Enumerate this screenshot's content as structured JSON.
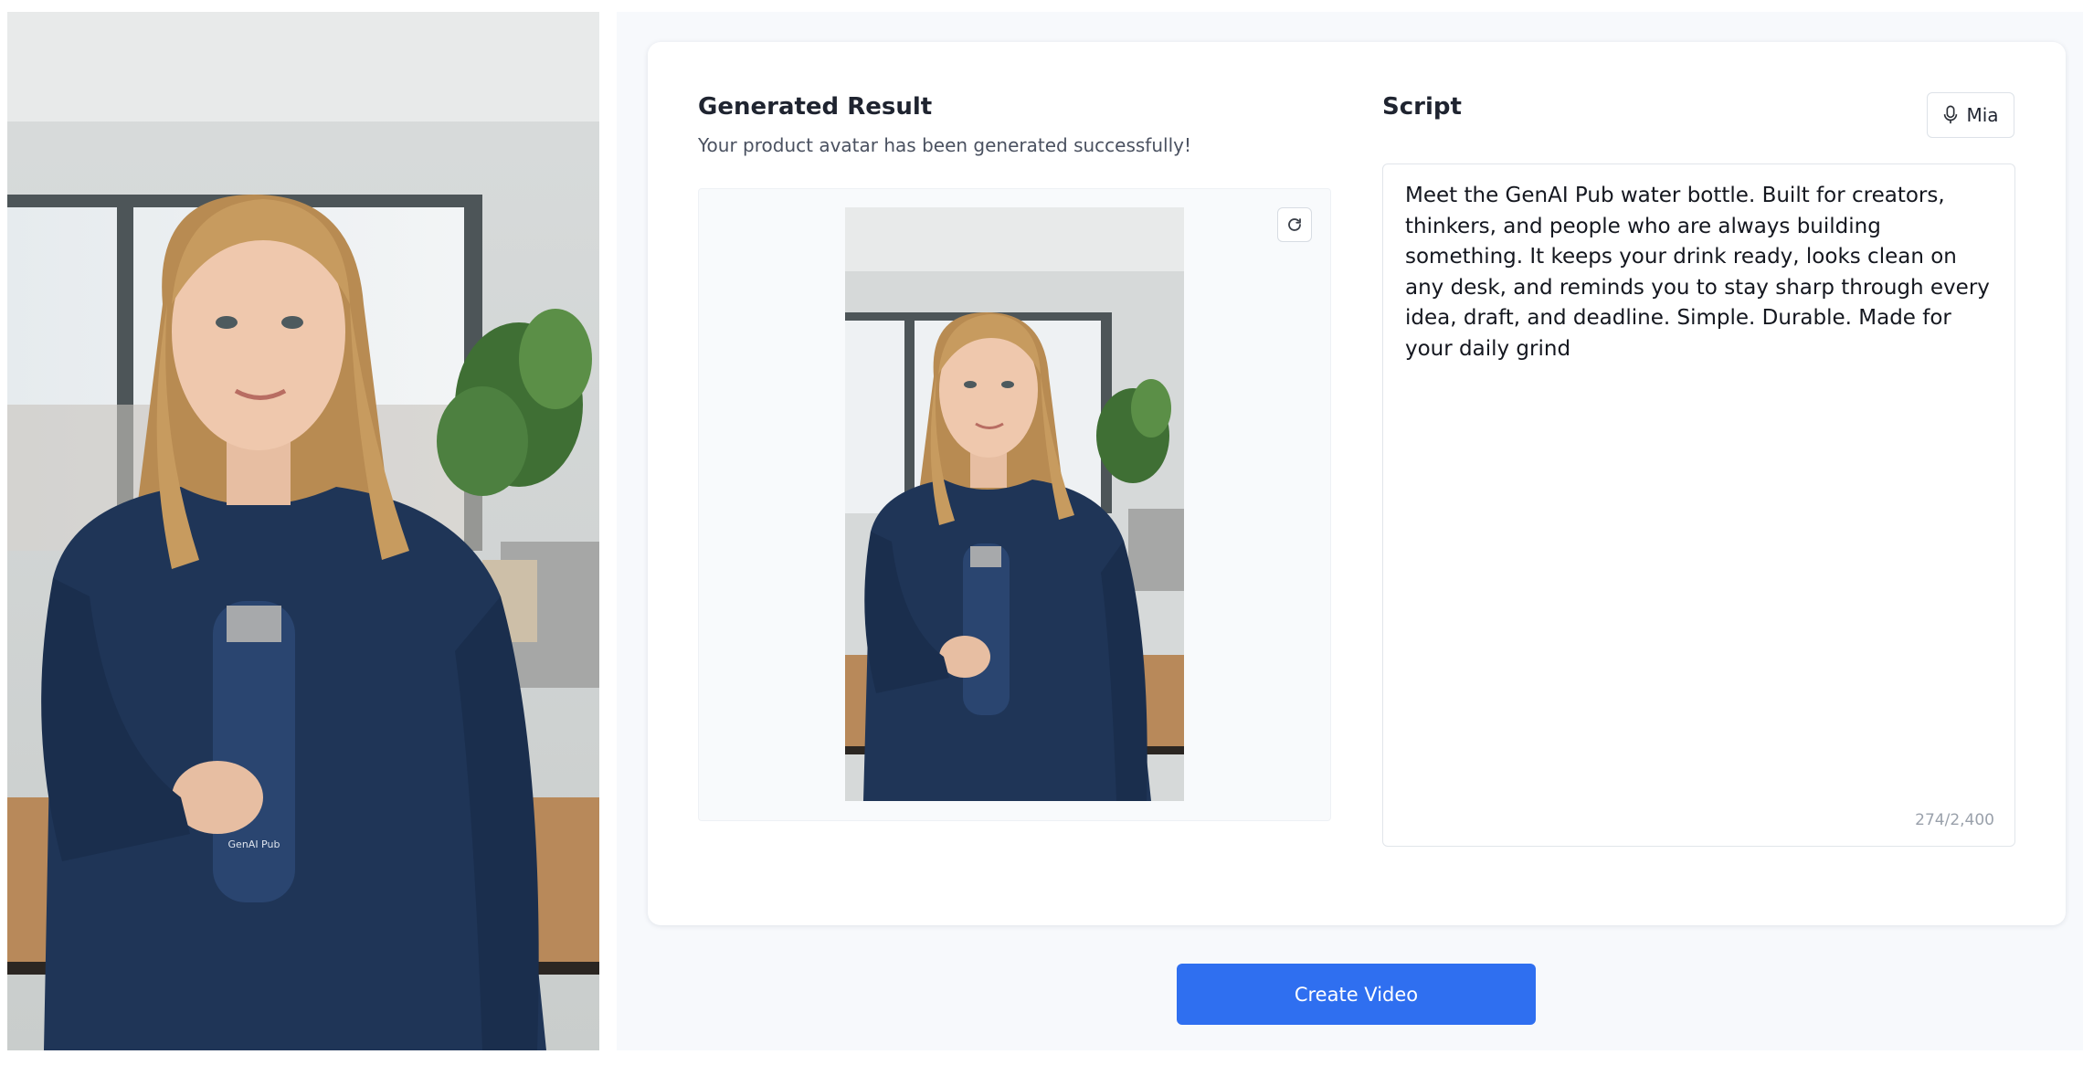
{
  "left_panel": {
    "photo_icon": "avatar-photo",
    "bottle_label": "GenAI Pub"
  },
  "result": {
    "title": "Generated Result",
    "subtitle": "Your product avatar has been generated successfully!",
    "preview_icon": "avatar-preview-image",
    "regenerate_icon": "refresh-icon"
  },
  "script": {
    "title": "Script",
    "voice_label": "Mia",
    "voice_icon": "microphone-icon",
    "text": "Meet the GenAI Pub water bottle. Built for creators, thinkers, and people who are always building something. It keeps your drink ready, looks clean on any desk, and reminds you to stay sharp through every idea, draft, and deadline. Simple. Durable. Made for your daily grind",
    "char_count": "274/2,400"
  },
  "actions": {
    "create_video_label": "Create Video"
  },
  "colors": {
    "primary": "#2f6ff0",
    "sweater": "#1f3557",
    "bottle": "#2a4570"
  }
}
